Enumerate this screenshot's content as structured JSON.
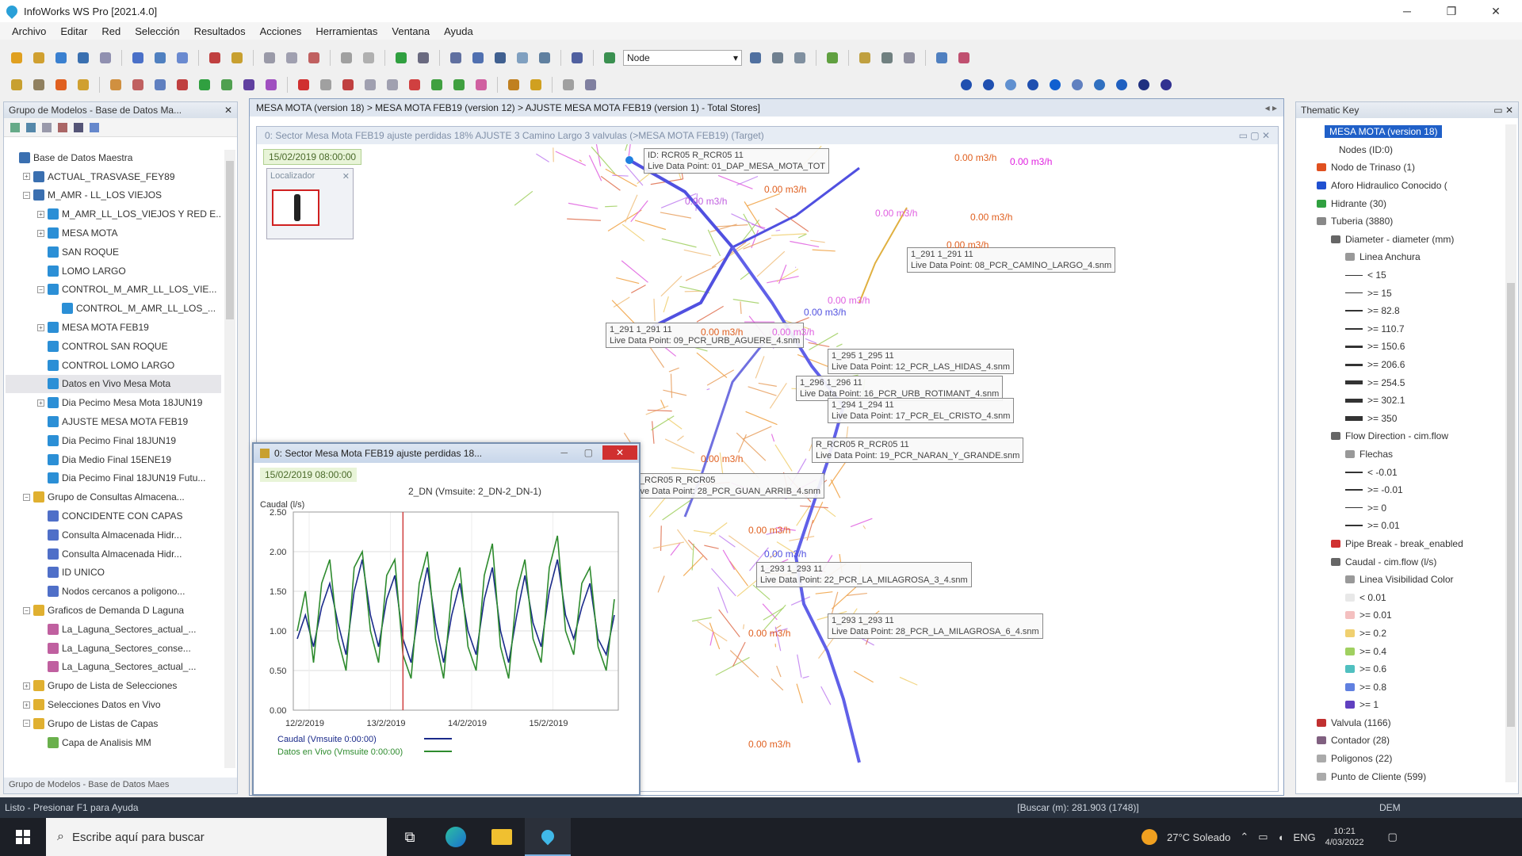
{
  "window": {
    "title": "InfoWorks WS Pro [2021.4.0]"
  },
  "menu": [
    "Archivo",
    "Editar",
    "Red",
    "Selección",
    "Resultados",
    "Acciones",
    "Herramientas",
    "Ventana",
    "Ayuda"
  ],
  "toolbar": {
    "node_select": "Node"
  },
  "model_group": {
    "header": "Grupo de Modelos - Base de Datos Ma...",
    "footer": "Grupo de Modelos - Base de Datos Maes",
    "items": [
      {
        "label": "Base de Datos Maestra",
        "level": 0,
        "exp": "",
        "color": "#3a6fb0"
      },
      {
        "label": "ACTUAL_TRASVASE_FEY89",
        "level": 1,
        "exp": "+",
        "color": "#3a6fb0"
      },
      {
        "label": "M_AMR - LL_LOS VIEJOS",
        "level": 1,
        "exp": "−",
        "color": "#3a6fb0"
      },
      {
        "label": "M_AMR_LL_LOS_VIEJOS Y RED E...",
        "level": 2,
        "exp": "+",
        "color": "#2b8fd6"
      },
      {
        "label": "MESA MOTA",
        "level": 2,
        "exp": "+",
        "color": "#2b8fd6"
      },
      {
        "label": "SAN ROQUE",
        "level": 2,
        "exp": "",
        "color": "#2b8fd6"
      },
      {
        "label": "LOMO LARGO",
        "level": 2,
        "exp": "",
        "color": "#2b8fd6"
      },
      {
        "label": "CONTROL_M_AMR_LL_LOS_VIE...",
        "level": 2,
        "exp": "−",
        "color": "#2b8fd6"
      },
      {
        "label": "CONTROL_M_AMR_LL_LOS_...",
        "level": 3,
        "exp": "",
        "color": "#2b8fd6"
      },
      {
        "label": "MESA MOTA FEB19",
        "level": 2,
        "exp": "+",
        "color": "#2b8fd6"
      },
      {
        "label": "CONTROL SAN ROQUE",
        "level": 2,
        "exp": "",
        "color": "#2b8fd6"
      },
      {
        "label": "CONTROL LOMO LARGO",
        "level": 2,
        "exp": "",
        "color": "#2b8fd6"
      },
      {
        "label": "Datos en Vivo Mesa Mota",
        "level": 2,
        "exp": "",
        "color": "#2b8fd6",
        "selected": true
      },
      {
        "label": "Dia Pecimo Mesa Mota 18JUN19",
        "level": 2,
        "exp": "+",
        "color": "#2b8fd6"
      },
      {
        "label": "AJUSTE MESA MOTA FEB19",
        "level": 2,
        "exp": "",
        "color": "#2b8fd6"
      },
      {
        "label": "Dia Pecimo Final 18JUN19",
        "level": 2,
        "exp": "",
        "color": "#2b8fd6"
      },
      {
        "label": "Dia Medio Final 15ENE19",
        "level": 2,
        "exp": "",
        "color": "#2b8fd6"
      },
      {
        "label": "Dia Pecimo Final 18JUN19 Futu...",
        "level": 2,
        "exp": "",
        "color": "#2b8fd6"
      },
      {
        "label": "Grupo de Consultas Almacena...",
        "level": 1,
        "exp": "−",
        "color": "#e0b030"
      },
      {
        "label": "CONCIDENTE CON CAPAS",
        "level": 2,
        "exp": "",
        "color": "#4f6fc8"
      },
      {
        "label": "Consulta Almacenada Hidr...",
        "level": 2,
        "exp": "",
        "color": "#4f6fc8"
      },
      {
        "label": "Consulta Almacenada Hidr...",
        "level": 2,
        "exp": "",
        "color": "#4f6fc8"
      },
      {
        "label": "ID UNICO",
        "level": 2,
        "exp": "",
        "color": "#4f6fc8"
      },
      {
        "label": "Nodos cercanos a poligono...",
        "level": 2,
        "exp": "",
        "color": "#4f6fc8"
      },
      {
        "label": "Graficos de Demanda D Laguna",
        "level": 1,
        "exp": "−",
        "color": "#e0b030"
      },
      {
        "label": "La_Laguna_Sectores_actual_...",
        "level": 2,
        "exp": "",
        "color": "#c060a0"
      },
      {
        "label": "La_Laguna_Sectores_conse...",
        "level": 2,
        "exp": "",
        "color": "#c060a0"
      },
      {
        "label": "La_Laguna_Sectores_actual_...",
        "level": 2,
        "exp": "",
        "color": "#c060a0"
      },
      {
        "label": "Grupo de Lista de Selecciones",
        "level": 1,
        "exp": "+",
        "color": "#e0b030"
      },
      {
        "label": "Selecciones Datos en Vivo",
        "level": 1,
        "exp": "+",
        "color": "#e0b030"
      },
      {
        "label": "Grupo de Listas de Capas",
        "level": 1,
        "exp": "−",
        "color": "#e0b030"
      },
      {
        "label": "Capa de Analisis MM",
        "level": 2,
        "exp": "",
        "color": "#6ab04c"
      }
    ]
  },
  "doc": {
    "tab": "MESA MOTA (version 18) > MESA MOTA FEB19 (version 12) > AJUSTE MESA MOTA FEB19 (version 1) - Total Stores]",
    "inner_title": "0: Sector Mesa Mota FEB19 ajuste perdidas 18% AJUSTE 3 Camino Largo 3 valvulas (>MESA MOTA FEB19) (Target)",
    "date": "15/02/2019 08:00:00",
    "locator": "Localizador"
  },
  "map": {
    "labels": [
      {
        "top": "ID: RCR05 R_RCR05 11",
        "bottom": "Live Data Point: 01_DAP_MESA_MOTA_TOT"
      },
      {
        "top": "1_291 1_291 11",
        "bottom": "Live Data Point: 08_PCR_CAMINO_LARGO_4.snm"
      },
      {
        "top": "1_291 1_291 11",
        "bottom": "Live Data Point: 09_PCR_URB_AGUERE_4.snm"
      },
      {
        "top": "1_295 1_295 11",
        "bottom": "Live Data Point: 12_PCR_LAS_HIDAS_4.snm"
      },
      {
        "top": "1_296 1_296 11",
        "bottom": "Live Data Point: 16_PCR_URB_ROTIMANT_4.snm"
      },
      {
        "top": "1_294 1_294 11",
        "bottom": "Live Data Point: 17_PCR_EL_CRISTO_4.snm"
      },
      {
        "top": "R_RCR05 R_RCR05 11",
        "bottom": "Live Data Point: 19_PCR_NARAN_Y_GRANDE.snm"
      },
      {
        "top": "R_RCR05 R_RCR05",
        "bottom": "Live Data Point: 28_PCR_GUAN_ARRIB_4.snm"
      },
      {
        "top": "1_293 1_293 11",
        "bottom": "Live Data Point: 22_PCR_LA_MILAGROSA_3_4.snm"
      },
      {
        "top": "1_293 1_293 11",
        "bottom": "Live Data Point: 28_PCR_LA_MILAGROSA_6_4.snm"
      }
    ],
    "flow_text": "0.00 m3/h"
  },
  "graph_window": {
    "title": "0: Sector Mesa Mota FEB19 ajuste perdidas 18...",
    "date": "15/02/2019 08:00:00",
    "ylabel": "Caudal (l/s)",
    "legend": [
      "Caudal (Vmsuite 0:00:00)",
      "Datos en Vivo (Vmsuite 0:00:00)"
    ]
  },
  "chart_data": {
    "type": "line",
    "title": "2_DN (Vmsuite: 2_DN-2_DN-1)",
    "ylabel": "Caudal (l/s)",
    "ylim": [
      0,
      2.5
    ],
    "yticks": [
      "2.50",
      "2.00",
      "1.50",
      "1.00",
      "0.50",
      "0.00"
    ],
    "xticks": [
      "12/2/2019",
      "13/2/2019",
      "14/2/2019",
      "15/2/2019"
    ],
    "series": [
      {
        "name": "Caudal (Vmsuite 0:00:00)",
        "color": "#1a2a8a",
        "values": [
          0.9,
          1.2,
          0.8,
          1.3,
          1.6,
          1.1,
          0.7,
          1.5,
          1.9,
          1.2,
          0.8,
          1.4,
          1.7,
          0.9,
          0.6,
          1.3,
          1.8,
          1.1,
          0.6,
          1.2,
          1.6,
          1.0,
          0.7,
          1.4,
          1.8,
          1.0,
          0.6,
          1.2,
          1.7,
          1.1,
          0.8,
          1.5,
          1.9,
          1.2,
          0.9,
          1.3,
          1.6,
          0.9,
          0.7,
          1.2
        ]
      },
      {
        "name": "Datos en Vivo (Vmsuite 0:00:00)",
        "color": "#2e8b2e",
        "values": [
          1.0,
          1.5,
          0.6,
          1.6,
          1.9,
          0.9,
          0.5,
          1.8,
          2.0,
          1.0,
          0.6,
          1.7,
          1.9,
          0.7,
          0.4,
          1.6,
          2.0,
          0.9,
          0.4,
          1.5,
          1.8,
          0.8,
          0.5,
          1.7,
          2.1,
          0.8,
          0.4,
          1.5,
          1.9,
          0.9,
          0.6,
          1.8,
          2.2,
          1.0,
          0.7,
          1.6,
          1.8,
          0.8,
          0.5,
          1.4
        ]
      }
    ],
    "cursor_index": 13
  },
  "thematic": {
    "header": "Thematic Key",
    "items": [
      {
        "label": "MESA MOTA (version 18)",
        "level": 0,
        "selected": true,
        "sw": "none"
      },
      {
        "label": "Nodes (ID:0)",
        "level": 1,
        "sw": "none"
      },
      {
        "label": "Nodo de Trinaso (1)",
        "level": 1,
        "sw": "#e05020"
      },
      {
        "label": "Aforo Hidraulico Conocido (",
        "level": 1,
        "sw": "#2050d0"
      },
      {
        "label": "Hidrante (30)",
        "level": 1,
        "sw": "#30a040"
      },
      {
        "label": "Tuberia (3880)",
        "level": 1,
        "sw": "#888"
      },
      {
        "label": "Diameter - diameter (mm)",
        "level": 2,
        "sw": "#666"
      },
      {
        "label": "Linea Anchura",
        "level": 3,
        "sw": "#999"
      },
      {
        "label": "< 15",
        "level": 3,
        "sw": "l1"
      },
      {
        "label": ">= 15",
        "level": 3,
        "sw": "l1"
      },
      {
        "label": ">= 82.8",
        "level": 3,
        "sw": "l2"
      },
      {
        "label": ">= 110.7",
        "level": 3,
        "sw": "l2"
      },
      {
        "label": ">= 150.6",
        "level": 3,
        "sw": "l3"
      },
      {
        "label": ">= 206.6",
        "level": 3,
        "sw": "l3"
      },
      {
        "label": ">= 254.5",
        "level": 3,
        "sw": "l4"
      },
      {
        "label": ">= 302.1",
        "level": 3,
        "sw": "l4"
      },
      {
        "label": ">= 350",
        "level": 3,
        "sw": "l5"
      },
      {
        "label": "Flow Direction - cim.flow",
        "level": 2,
        "sw": "#666"
      },
      {
        "label": "Flechas",
        "level": 3,
        "sw": "#999"
      },
      {
        "label": "< -0.01",
        "level": 3,
        "sw": "l2"
      },
      {
        "label": ">= -0.01",
        "level": 3,
        "sw": "l2"
      },
      {
        "label": ">= 0",
        "level": 3,
        "sw": "l1"
      },
      {
        "label": ">= 0.01",
        "level": 3,
        "sw": "l2"
      },
      {
        "label": "Pipe Break - break_enabled",
        "level": 2,
        "sw": "#d03030"
      },
      {
        "label": "Caudal - cim.flow (l/s)",
        "level": 2,
        "sw": "#666"
      },
      {
        "label": "Linea Visibilidad Color",
        "level": 3,
        "sw": "#999"
      },
      {
        "label": "< 0.01",
        "level": 3,
        "sw": "#e8e8e8"
      },
      {
        "label": ">= 0.01",
        "level": 3,
        "sw": "#f4c0c0"
      },
      {
        "label": ">= 0.2",
        "level": 3,
        "sw": "#f0d070"
      },
      {
        "label": ">= 0.4",
        "level": 3,
        "sw": "#a0d060"
      },
      {
        "label": ">= 0.6",
        "level": 3,
        "sw": "#50c0c0"
      },
      {
        "label": ">= 0.8",
        "level": 3,
        "sw": "#6080e0"
      },
      {
        "label": ">= 1",
        "level": 3,
        "sw": "#6040c0"
      },
      {
        "label": "Valvula (1166)",
        "level": 1,
        "sw": "#c03030"
      },
      {
        "label": "Contador (28)",
        "level": 1,
        "sw": "#806080"
      },
      {
        "label": "Poligonos (22)",
        "level": 1,
        "sw": "#aaa"
      },
      {
        "label": "Punto de Cliente (599)",
        "level": 1,
        "sw": "#aaa"
      }
    ]
  },
  "status": {
    "left": "Listo - Presionar F1 para Ayuda",
    "mid": "[Buscar (m): 281.903 (1748)]",
    "right": "DEM"
  },
  "taskbar": {
    "search_placeholder": "Escribe aquí para buscar",
    "weather": "27°C Soleado",
    "lang": "ENG",
    "time": "10:21",
    "date": "4/03/2022"
  }
}
